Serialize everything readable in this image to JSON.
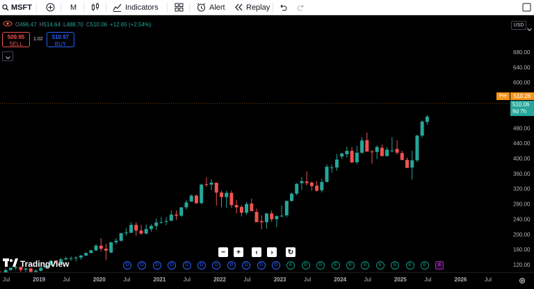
{
  "toolbar": {
    "symbol": "MSFT",
    "interval": "M",
    "indicators_label": "Indicators",
    "alert_label": "Alert",
    "replay_label": "Replay"
  },
  "legend": {
    "open_label": "O",
    "open": "496.47",
    "high_label": "H",
    "high": "514.64",
    "low_label": "L",
    "low": "488.70",
    "close_label": "C",
    "close": "510.06",
    "change": "+12.65 (+2.54%)"
  },
  "trade": {
    "sell_price": "509.95",
    "sell_label": "SELL",
    "spread": "1.02",
    "buy_price": "510.97",
    "buy_label": "BUY"
  },
  "price_axis": {
    "currency": "USD",
    "ticks": [
      "680.00",
      "640.00",
      "600.00",
      "560.00",
      "480.00",
      "440.00",
      "400.00",
      "360.00",
      "320.00",
      "280.00",
      "240.00",
      "200.00",
      "160.00",
      "120.00"
    ],
    "pre_label": "Pre",
    "pre_price": "510.28",
    "last_price": "510.06",
    "countdown": "9d 7h"
  },
  "time_axis": {
    "labels": [
      "Jul",
      "2019",
      "Jul",
      "2020",
      "Jul",
      "2021",
      "Jul",
      "2022",
      "Jul",
      "2023",
      "Jul",
      "2024",
      "Jul",
      "2025",
      "Jul",
      "2026",
      "Jul"
    ]
  },
  "watermark": "TradingView",
  "events": [
    "D",
    "D",
    "D",
    "D",
    "D",
    "D",
    "D",
    "D",
    "D",
    "D",
    "D",
    "E",
    "E",
    "E",
    "E",
    "E",
    "E",
    "E",
    "E",
    "E",
    "E",
    "E"
  ],
  "colors": {
    "up": "#26a69a",
    "down": "#ef5350",
    "background": "#000000",
    "pre_badge": "#f7931a",
    "last_badge": "#26a69a"
  },
  "chart_data": {
    "type": "candlestick",
    "x": [
      "2018-06",
      "2018-07",
      "2018-08",
      "2018-09",
      "2018-10",
      "2018-11",
      "2018-12",
      "2019-01",
      "2019-02",
      "2019-03",
      "2019-04",
      "2019-05",
      "2019-06",
      "2019-07",
      "2019-08",
      "2019-09",
      "2019-10",
      "2019-11",
      "2019-12",
      "2020-01",
      "2020-02",
      "2020-03",
      "2020-04",
      "2020-05",
      "2020-06",
      "2020-07",
      "2020-08",
      "2020-09",
      "2020-10",
      "2020-11",
      "2020-12",
      "2021-01",
      "2021-02",
      "2021-03",
      "2021-04",
      "2021-05",
      "2021-06",
      "2021-07",
      "2021-08",
      "2021-09",
      "2021-10",
      "2021-11",
      "2021-12",
      "2022-01",
      "2022-02",
      "2022-03",
      "2022-04",
      "2022-05",
      "2022-06",
      "2022-07",
      "2022-08",
      "2022-09",
      "2022-10",
      "2022-11",
      "2022-12",
      "2023-01",
      "2023-02",
      "2023-03",
      "2023-04",
      "2023-05",
      "2023-06",
      "2023-07",
      "2023-08",
      "2023-09",
      "2023-10",
      "2023-11",
      "2023-12",
      "2024-01",
      "2024-02",
      "2024-03",
      "2024-04",
      "2024-05",
      "2024-06",
      "2024-07",
      "2024-08",
      "2024-09",
      "2024-10",
      "2024-11",
      "2024-12",
      "2025-01",
      "2025-02",
      "2025-03",
      "2025-04",
      "2025-05",
      "2025-06",
      "2025-07"
    ],
    "open": [
      99,
      98,
      106,
      112,
      114,
      107,
      110,
      101,
      104,
      112,
      118,
      130,
      124,
      134,
      137,
      137,
      139,
      144,
      151,
      158,
      170,
      162,
      152,
      179,
      183,
      203,
      204,
      225,
      210,
      202,
      214,
      222,
      232,
      233,
      236,
      252,
      249,
      271,
      286,
      302,
      282,
      332,
      331,
      336,
      310,
      298,
      309,
      277,
      272,
      257,
      281,
      259,
      235,
      232,
      255,
      240,
      249,
      250,
      288,
      307,
      335,
      339,
      336,
      328,
      316,
      338,
      375,
      376,
      405,
      411,
      420,
      390,
      415,
      448,
      418,
      417,
      428,
      406,
      420,
      425,
      414,
      396,
      376,
      395,
      460,
      496
    ],
    "high": [
      103,
      111,
      112,
      116,
      115,
      111,
      112,
      108,
      113,
      120,
      131,
      131,
      138,
      141,
      142,
      142,
      146,
      152,
      159,
      174,
      190,
      175,
      180,
      190,
      204,
      216,
      232,
      232,
      225,
      226,
      227,
      242,
      246,
      245,
      263,
      263,
      272,
      290,
      305,
      305,
      333,
      350,
      345,
      336,
      315,
      315,
      315,
      290,
      277,
      285,
      294,
      268,
      250,
      256,
      263,
      250,
      276,
      288,
      310,
      335,
      351,
      366,
      339,
      340,
      346,
      384,
      384,
      411,
      415,
      431,
      430,
      433,
      456,
      468,
      422,
      434,
      437,
      430,
      456,
      448,
      420,
      402,
      420,
      462,
      500,
      515
    ],
    "low": [
      96,
      97,
      104,
      106,
      100,
      100,
      94,
      98,
      102,
      112,
      117,
      123,
      120,
      132,
      130,
      129,
      133,
      143,
      149,
      155,
      155,
      132,
      150,
      173,
      181,
      196,
      204,
      196,
      199,
      200,
      207,
      212,
      228,
      224,
      234,
      238,
      246,
      266,
      286,
      280,
      280,
      325,
      316,
      276,
      271,
      270,
      270,
      255,
      247,
      251,
      263,
      243,
      213,
      215,
      233,
      219,
      245,
      245,
      286,
      303,
      317,
      329,
      315,
      312,
      310,
      337,
      362,
      368,
      398,
      402,
      405,
      385,
      412,
      418,
      386,
      398,
      406,
      405,
      416,
      410,
      395,
      375,
      344,
      390,
      455,
      488
    ],
    "close": [
      98,
      106,
      112,
      114,
      106,
      110,
      101,
      104,
      112,
      117,
      130,
      124,
      134,
      137,
      137,
      139,
      144,
      151,
      158,
      170,
      162,
      157,
      179,
      183,
      203,
      205,
      225,
      210,
      202,
      214,
      222,
      231,
      232,
      235,
      252,
      249,
      271,
      284,
      302,
      282,
      331,
      330,
      336,
      310,
      298,
      309,
      277,
      271,
      257,
      280,
      261,
      232,
      232,
      255,
      240,
      248,
      249,
      288,
      307,
      333,
      340,
      335,
      327,
      315,
      338,
      378,
      376,
      397,
      413,
      420,
      389,
      415,
      447,
      418,
      417,
      430,
      406,
      423,
      421,
      415,
      396,
      375,
      395,
      460,
      497,
      510
    ],
    "ylim": [
      100,
      700
    ],
    "price_ticks": [
      120,
      160,
      200,
      240,
      280,
      320,
      360,
      400,
      440,
      480,
      560,
      600,
      640,
      680
    ]
  }
}
